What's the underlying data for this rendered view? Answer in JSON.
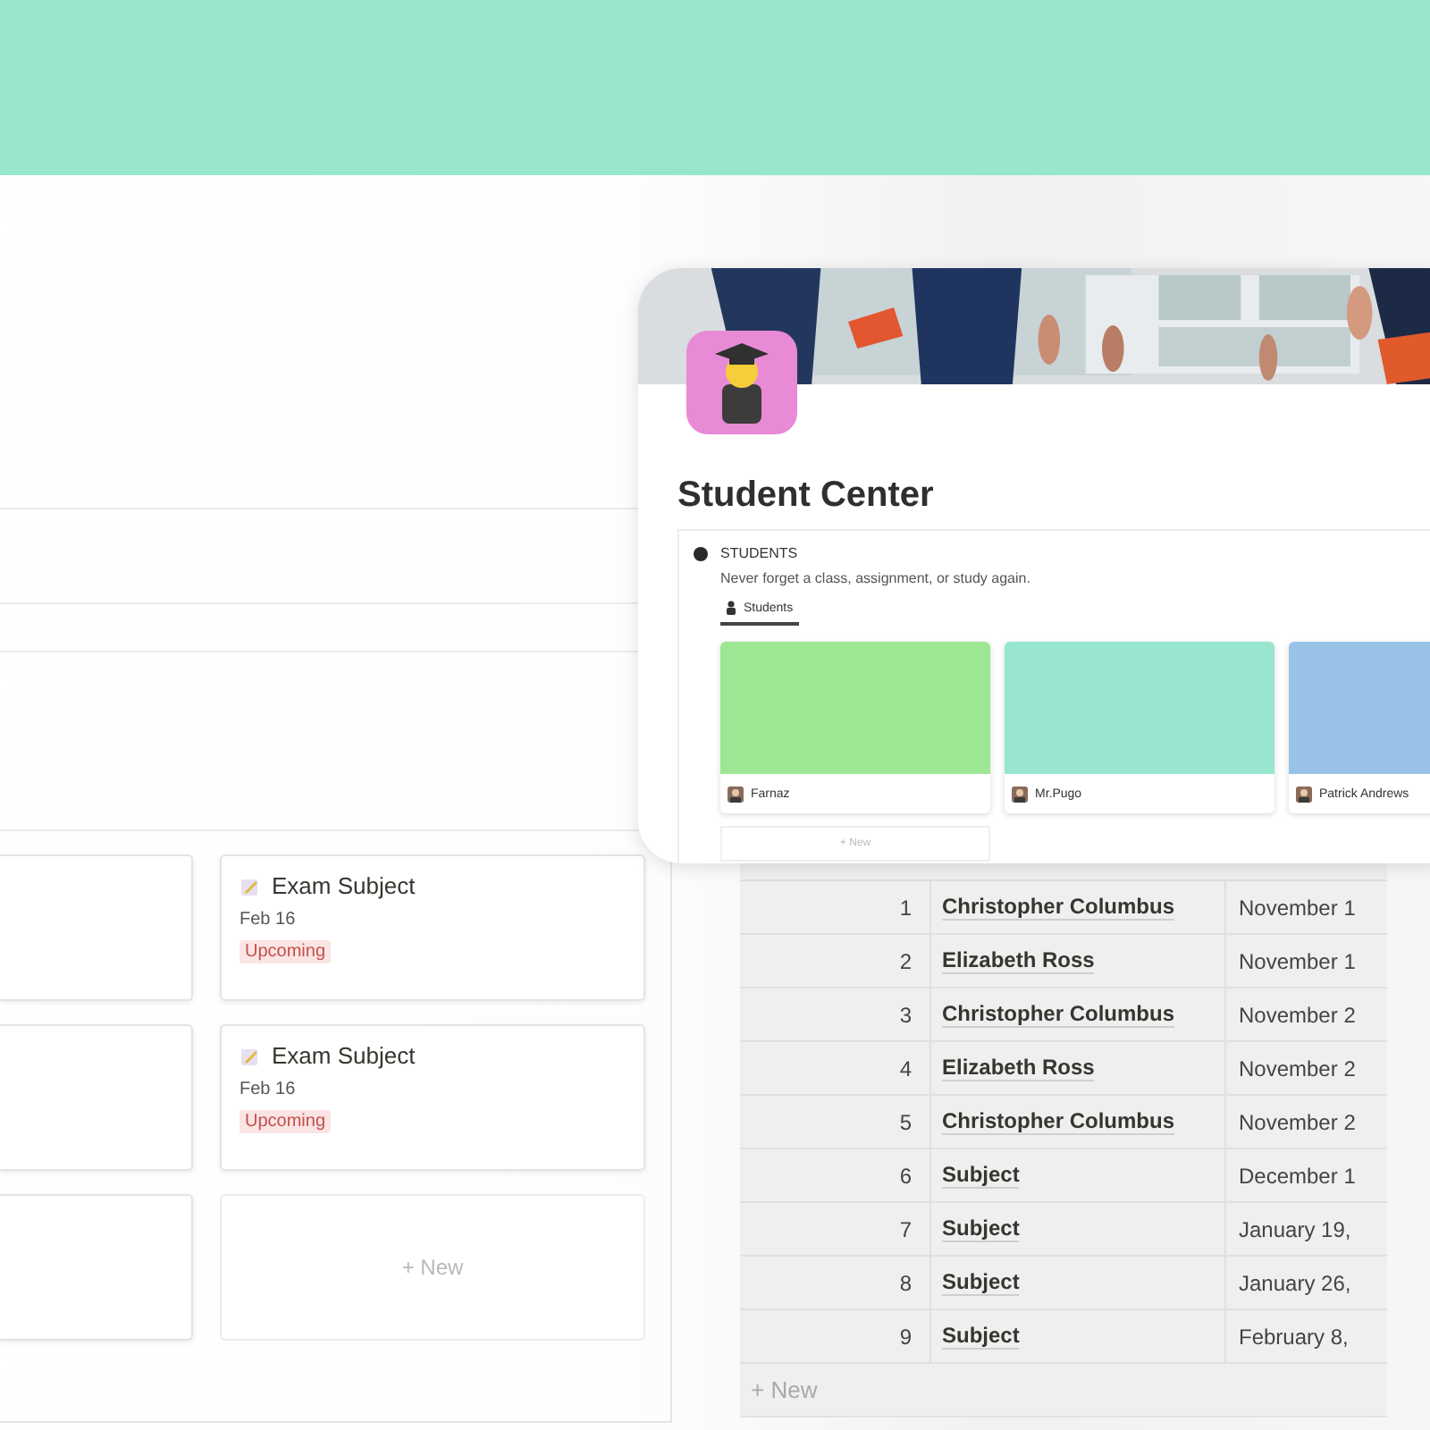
{
  "board": {
    "cards": [
      {
        "kind": "blank"
      },
      {
        "kind": "entry",
        "title": "Exam Subject",
        "date": "Feb 16",
        "status": "Upcoming"
      },
      {
        "kind": "blank"
      },
      {
        "kind": "entry",
        "title": "Exam Subject",
        "date": "Feb 16",
        "status": "Upcoming"
      },
      {
        "kind": "blank"
      },
      {
        "kind": "new",
        "label": "+ New"
      }
    ]
  },
  "table": {
    "rows": [
      {
        "order": "1",
        "topic": "Christopher Columbus",
        "due": "November 1"
      },
      {
        "order": "2",
        "topic": "Elizabeth Ross",
        "due": "November 1"
      },
      {
        "order": "3",
        "topic": "Christopher Columbus",
        "due": "November 2"
      },
      {
        "order": "4",
        "topic": "Elizabeth Ross",
        "due": "November 2"
      },
      {
        "order": "5",
        "topic": "Christopher Columbus",
        "due": "November 2"
      },
      {
        "order": "6",
        "topic": "Subject",
        "due": "December 1"
      },
      {
        "order": "7",
        "topic": "Subject",
        "due": "January 19,"
      },
      {
        "order": "8",
        "topic": "Subject",
        "due": "January 26,"
      },
      {
        "order": "9",
        "topic": "Subject",
        "due": "February 8,"
      }
    ],
    "new_label": "+ New"
  },
  "page": {
    "title": "Student Center",
    "callout": {
      "heading": "STUDENTS",
      "description": "Never forget a class, assignment, or study again.",
      "tabs": [
        {
          "label": "Students",
          "selected": true
        }
      ],
      "gallery": [
        {
          "name": "Farnaz",
          "color": "#9de694"
        },
        {
          "name": "Mr.Pugo",
          "color": "#98e6cf"
        },
        {
          "name": "Patrick Andrews",
          "color": "#98c3e6"
        }
      ],
      "new_label": "+ New"
    }
  }
}
